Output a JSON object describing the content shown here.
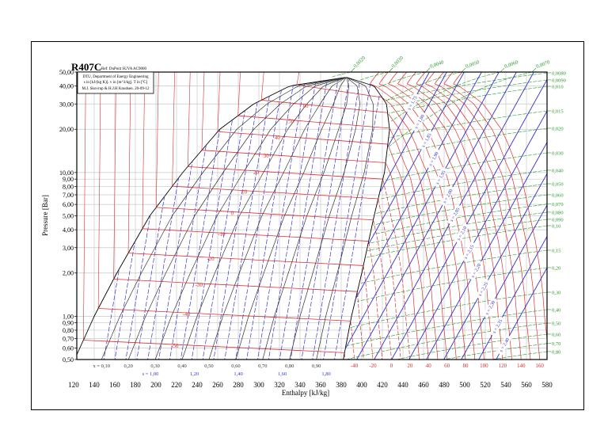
{
  "chart_data": {
    "type": "line",
    "title": "R407C",
    "subtitle": "Ref: DuPont SUVA AC9000",
    "info": [
      "DTU, Department of Energy Engineering",
      "s in [kJ/(kg K)]. v in [m^3/kg]. T in [ºC]",
      "M.J. Skovrup & H.J.H Knudsen. 20-09-12"
    ],
    "xlabel": "Enthalpy [kJ/kg]",
    "ylabel": "Pressure [Bar]",
    "xlim": [
      120,
      580
    ],
    "ylim": [
      0.5,
      50
    ],
    "yscale": "log",
    "grid": true,
    "x_ticks": [
      {
        "value": 120,
        "label": "120"
      },
      {
        "value": 140,
        "label": "140"
      },
      {
        "value": 160,
        "label": "160"
      },
      {
        "value": 180,
        "label": "180"
      },
      {
        "value": 200,
        "label": "200"
      },
      {
        "value": 220,
        "label": "220"
      },
      {
        "value": 240,
        "label": "240"
      },
      {
        "value": 260,
        "label": "260"
      },
      {
        "value": 280,
        "label": "280"
      },
      {
        "value": 300,
        "label": "300"
      },
      {
        "value": 320,
        "label": "320"
      },
      {
        "value": 340,
        "label": "340"
      },
      {
        "value": 360,
        "label": "360"
      },
      {
        "value": 380,
        "label": "380"
      },
      {
        "value": 400,
        "label": "400"
      },
      {
        "value": 420,
        "label": "420"
      },
      {
        "value": 440,
        "label": "440"
      },
      {
        "value": 460,
        "label": "460"
      },
      {
        "value": 480,
        "label": "480"
      },
      {
        "value": 500,
        "label": "500"
      },
      {
        "value": 520,
        "label": "520"
      },
      {
        "value": 540,
        "label": "540"
      },
      {
        "value": 560,
        "label": "560"
      },
      {
        "value": 580,
        "label": "580"
      }
    ],
    "y_ticks": [
      {
        "value": 50,
        "label": "50,00"
      },
      {
        "value": 40,
        "label": "40,00"
      },
      {
        "value": 30,
        "label": "30,00"
      },
      {
        "value": 20,
        "label": "20,00"
      },
      {
        "value": 10,
        "label": "10,00"
      },
      {
        "value": 9,
        "label": "9,00"
      },
      {
        "value": 8,
        "label": "8,00"
      },
      {
        "value": 7,
        "label": "7,00"
      },
      {
        "value": 6,
        "label": "6,00"
      },
      {
        "value": 5,
        "label": "5,00"
      },
      {
        "value": 4,
        "label": "4,00"
      },
      {
        "value": 3,
        "label": "3,00"
      },
      {
        "value": 2,
        "label": "2,00"
      },
      {
        "value": 1,
        "label": "1,00"
      },
      {
        "value": 0.9,
        "label": "0,90"
      },
      {
        "value": 0.8,
        "label": "0,80"
      },
      {
        "value": 0.7,
        "label": "0,70"
      },
      {
        "value": 0.6,
        "label": "0,60"
      },
      {
        "value": 0.5,
        "label": "0,50"
      }
    ],
    "isotherms": [
      {
        "T": -50,
        "label": "-50"
      },
      {
        "T": -40,
        "label": "-40"
      },
      {
        "T": -30,
        "label": "-30"
      },
      {
        "T": -20,
        "label": "-20"
      },
      {
        "T": -10,
        "label": "-10"
      },
      {
        "T": 0,
        "label": "0"
      },
      {
        "T": 10,
        "label": "10"
      },
      {
        "T": 20,
        "label": "20"
      },
      {
        "T": 30,
        "label": "30"
      },
      {
        "T": 40,
        "label": "40"
      },
      {
        "T": 50,
        "label": "50"
      },
      {
        "T": 60,
        "label": "60"
      }
    ],
    "isotherm_bottom_labels": [
      {
        "T": -40,
        "label": "-40"
      },
      {
        "T": -20,
        "label": "-20"
      },
      {
        "T": 0,
        "label": "0"
      },
      {
        "T": 20,
        "label": "20"
      },
      {
        "T": 40,
        "label": "40"
      },
      {
        "T": 60,
        "label": "60"
      },
      {
        "T": 80,
        "label": "80"
      },
      {
        "T": 100,
        "label": "100"
      },
      {
        "T": 120,
        "label": "120"
      },
      {
        "T": 140,
        "label": "140"
      },
      {
        "T": 160,
        "label": "160"
      }
    ],
    "quality_labels": [
      {
        "x": 0.1,
        "label": "x = 0,10"
      },
      {
        "x": 0.2,
        "label": "0,20"
      },
      {
        "x": 0.3,
        "label": "0,30"
      },
      {
        "x": 0.4,
        "label": "0,40"
      },
      {
        "x": 0.5,
        "label": "0,50"
      },
      {
        "x": 0.6,
        "label": "0,60"
      },
      {
        "x": 0.7,
        "label": "0,70"
      },
      {
        "x": 0.8,
        "label": "0,80"
      },
      {
        "x": 0.9,
        "label": "0,90"
      }
    ],
    "entropy_dome_labels": [
      {
        "s": 1.0,
        "label": "s = 1,00"
      },
      {
        "s": 1.2,
        "label": "1,20"
      },
      {
        "s": 1.4,
        "label": "1,40"
      },
      {
        "s": 1.6,
        "label": "1,60"
      },
      {
        "s": 1.8,
        "label": "1,80"
      }
    ],
    "entropy_vapor_labels": [
      {
        "s": 1.75,
        "label": "s = 1,75"
      },
      {
        "s": 1.8,
        "label": "s = 1,80"
      },
      {
        "s": 1.85,
        "label": "s = 1,85"
      },
      {
        "s": 1.9,
        "label": "s = 1,90"
      },
      {
        "s": 1.95,
        "label": "s = 1,95"
      },
      {
        "s": 2.0,
        "label": "s = 2,00"
      },
      {
        "s": 2.05,
        "label": "s = 2,05"
      },
      {
        "s": 2.1,
        "label": "s = 2,10"
      },
      {
        "s": 2.15,
        "label": "s = 2,15"
      },
      {
        "s": 2.2,
        "label": "s = 2,20"
      },
      {
        "s": 2.25,
        "label": "s = 2,25"
      },
      {
        "s": 2.3,
        "label": "s = 2,30"
      },
      {
        "s": 2.35,
        "label": "s = 2,35"
      },
      {
        "s": 2.4,
        "label": "s = 2,40"
      }
    ],
    "volume_top_labels": [
      {
        "v": 0.002,
        "label": "0,0020"
      },
      {
        "v": 0.003,
        "label": "0,0030"
      },
      {
        "v": 0.004,
        "label": "0,0040"
      },
      {
        "v": 0.005,
        "label": "0,0050"
      },
      {
        "v": 0.006,
        "label": "0,0060"
      },
      {
        "v": 0.007,
        "label": "0,0070"
      }
    ],
    "volume_right_labels": [
      {
        "v": 0.008,
        "label": "0,0080"
      },
      {
        "v": 0.009,
        "label": "0,0090"
      },
      {
        "v": 0.01,
        "label": "0,010"
      },
      {
        "v": 0.015,
        "label": "0,015"
      },
      {
        "v": 0.02,
        "label": "0,020"
      },
      {
        "v": 0.03,
        "label": "0,030"
      },
      {
        "v": 0.04,
        "label": "0,040"
      },
      {
        "v": 0.05,
        "label": "0,050"
      },
      {
        "v": 0.06,
        "label": "0,060"
      },
      {
        "v": 0.07,
        "label": "0,070"
      },
      {
        "v": 0.08,
        "label": "0,080"
      },
      {
        "v": 0.09,
        "label": "0,090"
      },
      {
        "v": 0.1,
        "label": "0,10"
      },
      {
        "v": 0.15,
        "label": "0,15"
      },
      {
        "v": 0.2,
        "label": "0,20"
      },
      {
        "v": 0.3,
        "label": "0,30"
      },
      {
        "v": 0.4,
        "label": "0,40"
      },
      {
        "v": 0.5,
        "label": "0,50"
      },
      {
        "v": 0.6,
        "label": "0,60"
      },
      {
        "v": 0.7,
        "label": "0,70"
      },
      {
        "v": 0.8,
        "label": "0,80"
      }
    ],
    "colors": {
      "isotherm": "#e03030",
      "entropy": "#3535d0",
      "volume": "#2a9a2a",
      "quality": "#333333",
      "grid": "#c8c8c8"
    }
  }
}
